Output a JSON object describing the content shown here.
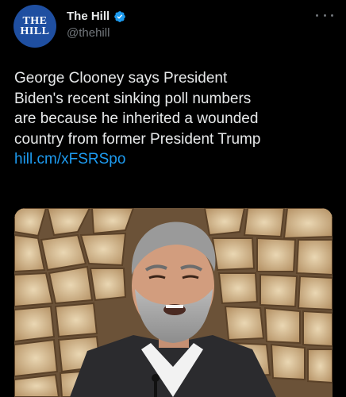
{
  "header": {
    "avatar_line1": "THE",
    "avatar_line2": "HILL",
    "display_name": "The Hill",
    "handle": "@thehill",
    "verified_icon": "verified-badge-icon",
    "more_icon": "more-options-icon"
  },
  "tweet": {
    "lines": [
      "George Clooney says President",
      "Biden's recent sinking poll numbers",
      "are because he inherited a wounded",
      "country from former President Trump"
    ],
    "link": "hill.cm/xFSRSpo"
  },
  "colors": {
    "background": "#000000",
    "text": "#e7e9ea",
    "secondary_text": "#71767b",
    "link": "#1d9bf0",
    "verified": "#1d9bf0",
    "avatar_bg": "#1f4fa1"
  }
}
